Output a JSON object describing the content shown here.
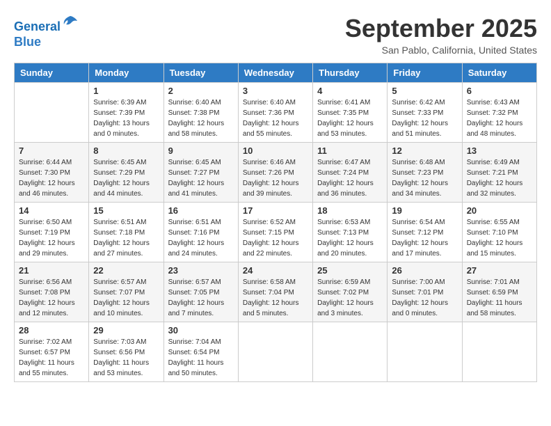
{
  "header": {
    "logo_line1": "General",
    "logo_line2": "Blue",
    "month": "September 2025",
    "location": "San Pablo, California, United States"
  },
  "weekdays": [
    "Sunday",
    "Monday",
    "Tuesday",
    "Wednesday",
    "Thursday",
    "Friday",
    "Saturday"
  ],
  "weeks": [
    [
      {
        "day": "",
        "info": ""
      },
      {
        "day": "1",
        "info": "Sunrise: 6:39 AM\nSunset: 7:39 PM\nDaylight: 13 hours\nand 0 minutes."
      },
      {
        "day": "2",
        "info": "Sunrise: 6:40 AM\nSunset: 7:38 PM\nDaylight: 12 hours\nand 58 minutes."
      },
      {
        "day": "3",
        "info": "Sunrise: 6:40 AM\nSunset: 7:36 PM\nDaylight: 12 hours\nand 55 minutes."
      },
      {
        "day": "4",
        "info": "Sunrise: 6:41 AM\nSunset: 7:35 PM\nDaylight: 12 hours\nand 53 minutes."
      },
      {
        "day": "5",
        "info": "Sunrise: 6:42 AM\nSunset: 7:33 PM\nDaylight: 12 hours\nand 51 minutes."
      },
      {
        "day": "6",
        "info": "Sunrise: 6:43 AM\nSunset: 7:32 PM\nDaylight: 12 hours\nand 48 minutes."
      }
    ],
    [
      {
        "day": "7",
        "info": "Sunrise: 6:44 AM\nSunset: 7:30 PM\nDaylight: 12 hours\nand 46 minutes."
      },
      {
        "day": "8",
        "info": "Sunrise: 6:45 AM\nSunset: 7:29 PM\nDaylight: 12 hours\nand 44 minutes."
      },
      {
        "day": "9",
        "info": "Sunrise: 6:45 AM\nSunset: 7:27 PM\nDaylight: 12 hours\nand 41 minutes."
      },
      {
        "day": "10",
        "info": "Sunrise: 6:46 AM\nSunset: 7:26 PM\nDaylight: 12 hours\nand 39 minutes."
      },
      {
        "day": "11",
        "info": "Sunrise: 6:47 AM\nSunset: 7:24 PM\nDaylight: 12 hours\nand 36 minutes."
      },
      {
        "day": "12",
        "info": "Sunrise: 6:48 AM\nSunset: 7:23 PM\nDaylight: 12 hours\nand 34 minutes."
      },
      {
        "day": "13",
        "info": "Sunrise: 6:49 AM\nSunset: 7:21 PM\nDaylight: 12 hours\nand 32 minutes."
      }
    ],
    [
      {
        "day": "14",
        "info": "Sunrise: 6:50 AM\nSunset: 7:19 PM\nDaylight: 12 hours\nand 29 minutes."
      },
      {
        "day": "15",
        "info": "Sunrise: 6:51 AM\nSunset: 7:18 PM\nDaylight: 12 hours\nand 27 minutes."
      },
      {
        "day": "16",
        "info": "Sunrise: 6:51 AM\nSunset: 7:16 PM\nDaylight: 12 hours\nand 24 minutes."
      },
      {
        "day": "17",
        "info": "Sunrise: 6:52 AM\nSunset: 7:15 PM\nDaylight: 12 hours\nand 22 minutes."
      },
      {
        "day": "18",
        "info": "Sunrise: 6:53 AM\nSunset: 7:13 PM\nDaylight: 12 hours\nand 20 minutes."
      },
      {
        "day": "19",
        "info": "Sunrise: 6:54 AM\nSunset: 7:12 PM\nDaylight: 12 hours\nand 17 minutes."
      },
      {
        "day": "20",
        "info": "Sunrise: 6:55 AM\nSunset: 7:10 PM\nDaylight: 12 hours\nand 15 minutes."
      }
    ],
    [
      {
        "day": "21",
        "info": "Sunrise: 6:56 AM\nSunset: 7:08 PM\nDaylight: 12 hours\nand 12 minutes."
      },
      {
        "day": "22",
        "info": "Sunrise: 6:57 AM\nSunset: 7:07 PM\nDaylight: 12 hours\nand 10 minutes."
      },
      {
        "day": "23",
        "info": "Sunrise: 6:57 AM\nSunset: 7:05 PM\nDaylight: 12 hours\nand 7 minutes."
      },
      {
        "day": "24",
        "info": "Sunrise: 6:58 AM\nSunset: 7:04 PM\nDaylight: 12 hours\nand 5 minutes."
      },
      {
        "day": "25",
        "info": "Sunrise: 6:59 AM\nSunset: 7:02 PM\nDaylight: 12 hours\nand 3 minutes."
      },
      {
        "day": "26",
        "info": "Sunrise: 7:00 AM\nSunset: 7:01 PM\nDaylight: 12 hours\nand 0 minutes."
      },
      {
        "day": "27",
        "info": "Sunrise: 7:01 AM\nSunset: 6:59 PM\nDaylight: 11 hours\nand 58 minutes."
      }
    ],
    [
      {
        "day": "28",
        "info": "Sunrise: 7:02 AM\nSunset: 6:57 PM\nDaylight: 11 hours\nand 55 minutes."
      },
      {
        "day": "29",
        "info": "Sunrise: 7:03 AM\nSunset: 6:56 PM\nDaylight: 11 hours\nand 53 minutes."
      },
      {
        "day": "30",
        "info": "Sunrise: 7:04 AM\nSunset: 6:54 PM\nDaylight: 11 hours\nand 50 minutes."
      },
      {
        "day": "",
        "info": ""
      },
      {
        "day": "",
        "info": ""
      },
      {
        "day": "",
        "info": ""
      },
      {
        "day": "",
        "info": ""
      }
    ]
  ]
}
